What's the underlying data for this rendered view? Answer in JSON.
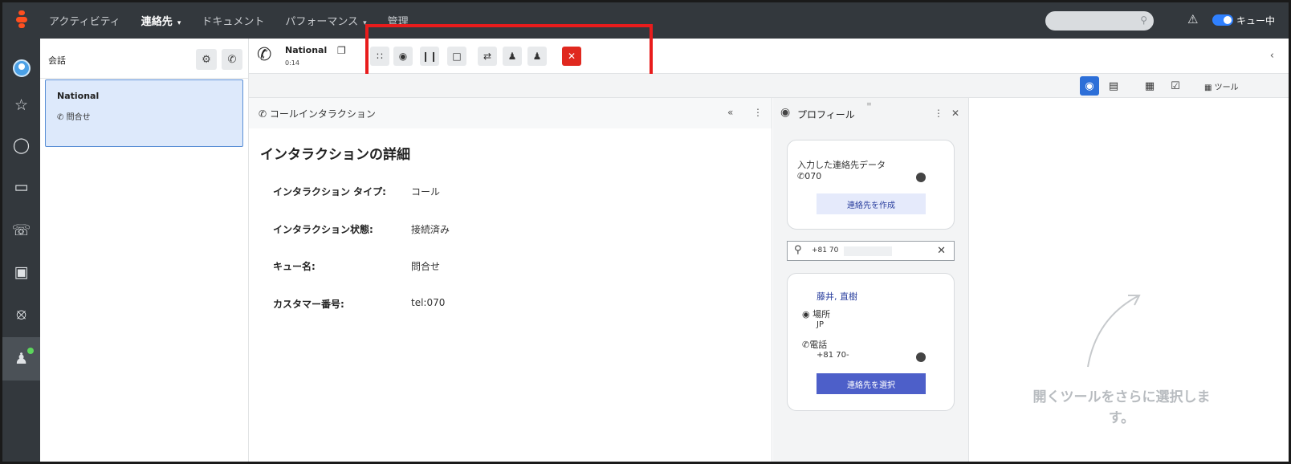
{
  "topbar": {
    "nav": [
      {
        "label": "アクティビティ",
        "active": false,
        "caret": false
      },
      {
        "label": "連絡先",
        "active": true,
        "caret": true
      },
      {
        "label": "ドキュメント",
        "active": false,
        "caret": false
      },
      {
        "label": "パフォーマンス",
        "active": false,
        "caret": true
      },
      {
        "label": "管理",
        "active": false,
        "caret": false
      }
    ],
    "status_label": "キュー中"
  },
  "conversations": {
    "title": "会話",
    "items": [
      {
        "name": "National",
        "subtitle": "問合せ"
      }
    ]
  },
  "call": {
    "name": "National",
    "duration": "0:14"
  },
  "tools": {
    "label": "ツール"
  },
  "interaction": {
    "panel_title": "コールインタラクション",
    "heading": "インタラクションの詳細",
    "rows": [
      {
        "label": "インタラクション タイプ:",
        "value": "コール"
      },
      {
        "label": "インタラクション状態:",
        "value": "接続済み"
      },
      {
        "label": "キュー名:",
        "value": "問合せ"
      },
      {
        "label": "カスタマー番号:",
        "value": "tel:070"
      }
    ]
  },
  "profile": {
    "panel_title": "プロフィール",
    "entered": {
      "title": "入力した連絡先データ",
      "phone": "070",
      "button": "連絡先を作成"
    },
    "search_value": "+81 70",
    "match": {
      "name": "藤井, 直樹",
      "location_label": "場所",
      "location_value": "JP",
      "phone_label": "電話",
      "phone_value": "+81 70-",
      "button": "連絡先を選択"
    }
  },
  "empty_hint": "開くツールをさらに選択します。",
  "colors": {
    "accent": "#2d6fd8",
    "disconnect": "#e0281f",
    "highlight_box": "#e81c1c",
    "topbar": "#33383d"
  }
}
